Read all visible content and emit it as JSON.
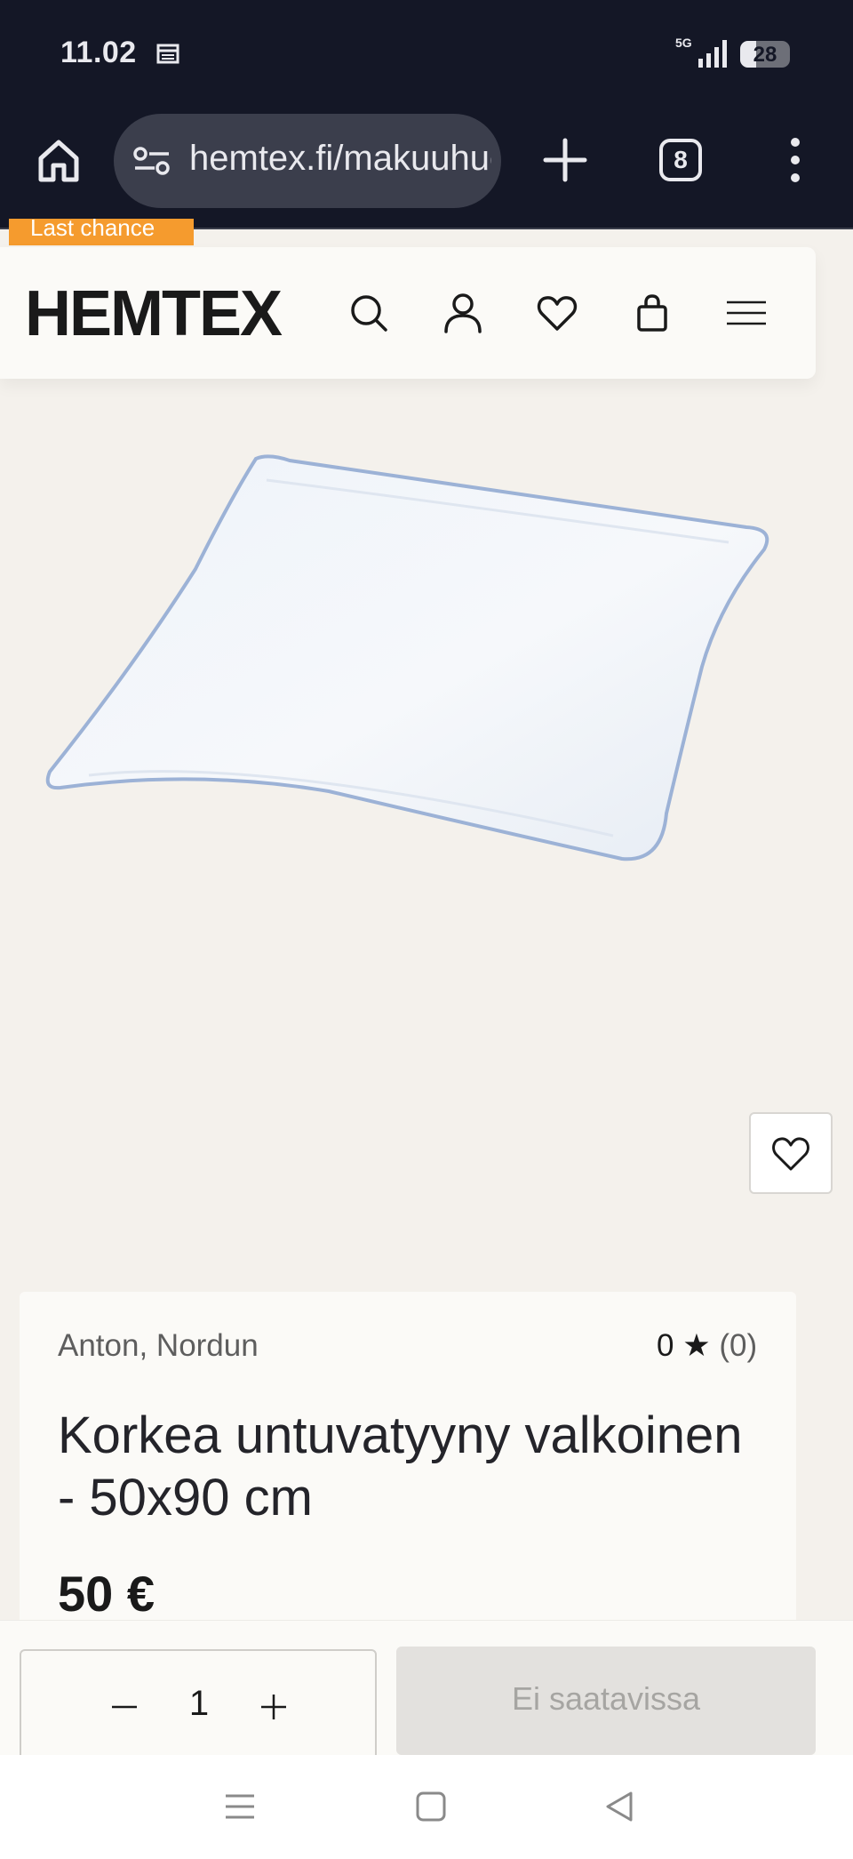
{
  "status_bar": {
    "time": "11.02",
    "network": "5G",
    "battery": "28"
  },
  "browser": {
    "url": "hemtex.fi/makuuhuone",
    "tab_count": "8"
  },
  "promo": {
    "label": "Last chance"
  },
  "header": {
    "logo": "HEMTEX"
  },
  "product": {
    "brand": "Anton, Nordun",
    "rating_value": "0",
    "rating_star": "★",
    "rating_count": "(0)",
    "title": "Korkea untuvatyyny valkoinen - 50x90 cm",
    "price": "50 €"
  },
  "purchase": {
    "quantity": "1",
    "button_label": "Ei saatavissa"
  },
  "icons": {
    "home": "home-icon",
    "site_settings": "site-settings-icon",
    "new_tab": "plus-icon",
    "menu": "more-vert-icon",
    "search": "search-icon",
    "account": "user-icon",
    "wishlist": "heart-icon",
    "cart": "shopping-bag-icon",
    "hamburger": "menu-icon"
  },
  "colors": {
    "status_bg": "#141726",
    "page_bg": "#f4f1ec",
    "promo": "#f59b2e",
    "disabled_button": "#e3e1de"
  }
}
